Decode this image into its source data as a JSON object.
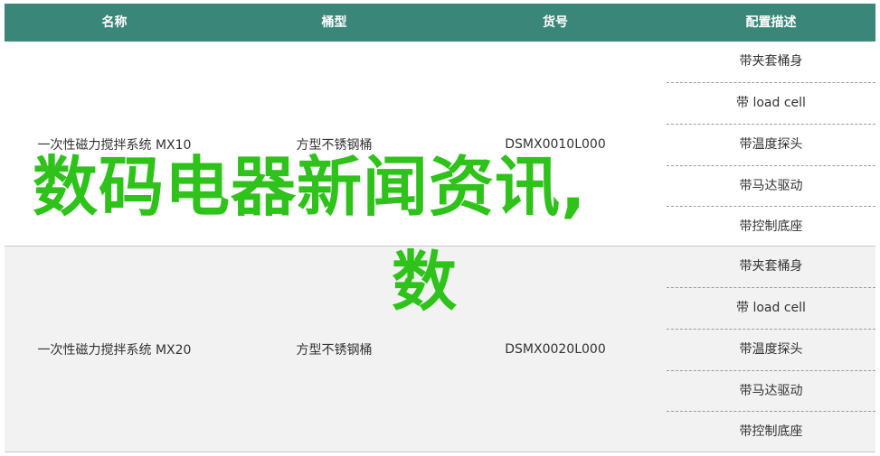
{
  "headers": [
    "名称",
    "桶型",
    "货号",
    "配置描述"
  ],
  "rows": [
    {
      "name": "一次性磁力搅拌系统 MX10",
      "bucket": "方型不锈钢桶",
      "sku": "DSMX0010L000",
      "config": [
        "带夹套桶身",
        "带 load cell",
        "带温度探头",
        "带马达驱动",
        "带控制底座"
      ]
    },
    {
      "name": "一次性磁力搅拌系统 MX20",
      "bucket": "方型不锈钢桶",
      "sku": "DSMX0020L000",
      "config": [
        "带夹套桶身",
        "带 load cell",
        "带温度探头",
        "带马达驱动",
        "带控制底座"
      ]
    }
  ],
  "overlay": {
    "title": "数码电器新闻资讯,",
    "sub": "数"
  },
  "colors": {
    "header_bg": "#3a8779",
    "overlay_text": "#2ec21a",
    "alt_row_bg": "#f2f2f2"
  }
}
